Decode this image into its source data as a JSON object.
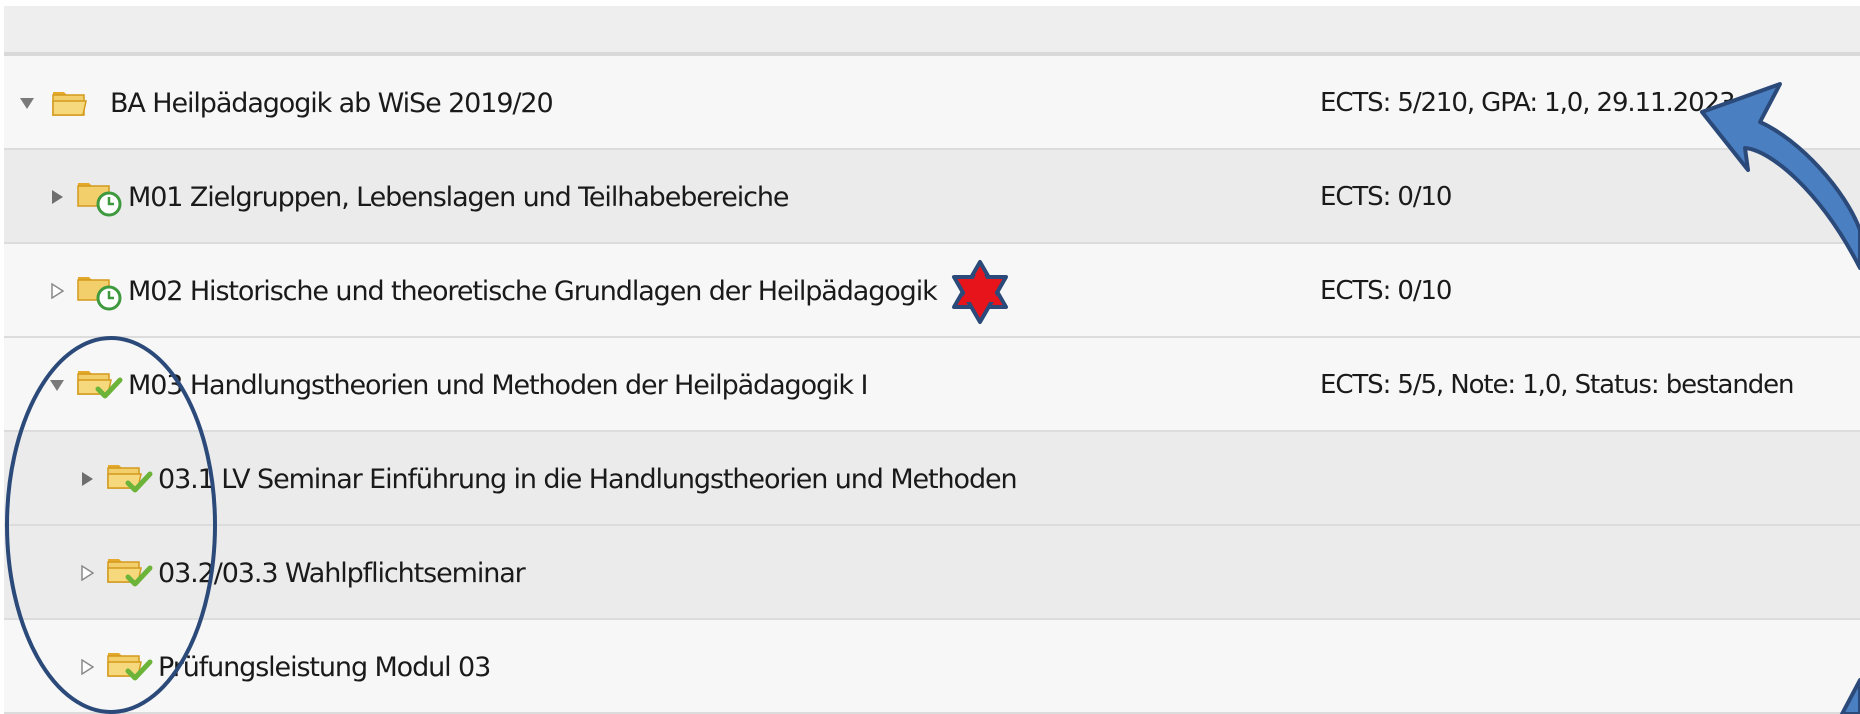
{
  "tree": {
    "rows": [
      {
        "label": "BA Heilpädagogik ab WiSe 2019/20",
        "info": "ECTS: 5/210, GPA: 1,0, 29.11.2023",
        "expanded": true,
        "icon": "open-folder-icon"
      },
      {
        "label": "M01 Zielgruppen, Lebenslagen und Teilhabebereiche",
        "info": "ECTS: 0/10",
        "expanded": false,
        "icon": "folder-clock-icon"
      },
      {
        "label": "M02 Historische und theoretische Grundlagen der Heilpädagogik",
        "info": "ECTS: 0/10",
        "expanded": false,
        "icon": "folder-clock-icon"
      },
      {
        "label": "M03 Handlungstheorien und Methoden der Heilpädagogik I",
        "info": "ECTS: 5/5, Note: 1,0, Status: bestanden",
        "expanded": true,
        "icon": "folder-check-icon"
      },
      {
        "label": "03.1 LV Seminar Einführung in die Handlungstheorien und Methoden",
        "info": "",
        "expanded": false,
        "icon": "folder-check-icon"
      },
      {
        "label": "03.2/03.3 Wahlpflichtseminar",
        "info": "",
        "expanded": false,
        "icon": "folder-check-icon"
      },
      {
        "label": "Prüfungsleistung Modul 03",
        "info": "",
        "expanded": false,
        "icon": "folder-check-icon"
      }
    ]
  },
  "colors": {
    "folder": "#f0c24b",
    "check": "#7cc243",
    "clock": "#4caf50",
    "annotation": "#2b4a7a",
    "arrow_fill": "#4a7fc1",
    "star": "#e8141c"
  },
  "annotations": {
    "star_icon": "red-star-icon",
    "ellipse": "highlight-ellipse",
    "arrow": "curved-arrow"
  }
}
